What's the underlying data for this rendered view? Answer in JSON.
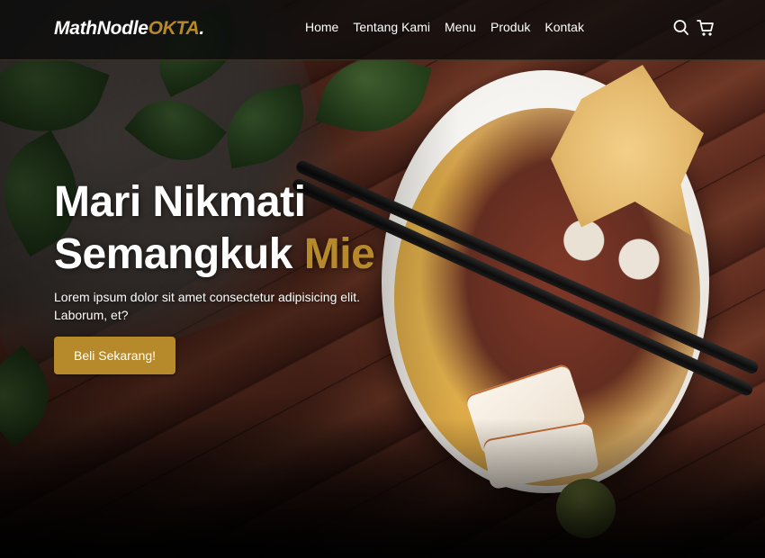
{
  "brand": {
    "name_main": "MathNodle",
    "name_accent": "OKTA",
    "name_suffix": "."
  },
  "nav": {
    "items": [
      "Home",
      "Tentang Kami",
      "Menu",
      "Produk",
      "Kontak"
    ]
  },
  "icons": {
    "search": "search-icon",
    "cart": "shopping-cart-icon"
  },
  "hero": {
    "title_line1": "Mari Nikmati",
    "title_line2_main": "Semangkuk",
    "title_line2_accent": "Mie",
    "text": "Lorem ipsum dolor sit amet consectetur adipisicing elit. Laborum, et?",
    "cta_label": "Beli Sekarang!",
    "background": "bowl of noodles with chopsticks on a wooden table"
  },
  "colors": {
    "accent": "#b6892a",
    "navbar_bg": "#0c0c0c",
    "text": "#ffffff"
  }
}
